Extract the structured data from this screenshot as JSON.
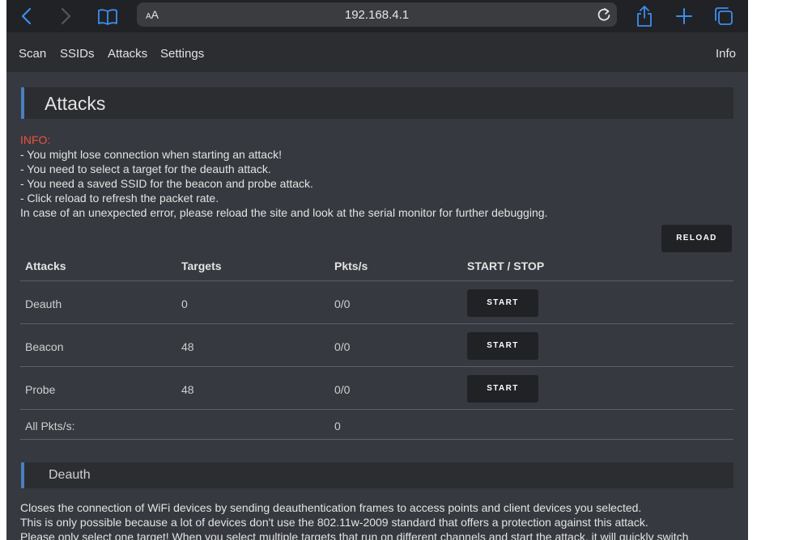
{
  "browser": {
    "url": "192.168.4.1",
    "text_size_label": "AA"
  },
  "nav": {
    "items": [
      {
        "label": "Scan"
      },
      {
        "label": "SSIDs"
      },
      {
        "label": "Attacks"
      },
      {
        "label": "Settings"
      }
    ],
    "right_item": "Info"
  },
  "page": {
    "title": "Attacks"
  },
  "info": {
    "label": "INFO:",
    "lines": [
      "- You might lose connection when starting an attack!",
      "- You need to select a target for the deauth attack.",
      "- You need a saved SSID for the beacon and probe attack.",
      "- Click reload to refresh the packet rate.",
      "In case of an unexpected error, please reload the site and look at the serial monitor for further debugging."
    ]
  },
  "reload_label": "RELOAD",
  "table": {
    "headers": [
      "Attacks",
      "Targets",
      "Pkts/s",
      "START / STOP"
    ],
    "rows": [
      {
        "attack": "Deauth",
        "targets": "0",
        "pkts": "0/0",
        "button": "START"
      },
      {
        "attack": "Beacon",
        "targets": "48",
        "pkts": "0/0",
        "button": "START"
      },
      {
        "attack": "Probe",
        "targets": "48",
        "pkts": "0/0",
        "button": "START"
      }
    ],
    "total_label": "All Pkts/s:",
    "total_value": "0"
  },
  "deauth_section": {
    "title": "Deauth",
    "lines": [
      "Closes the connection of WiFi devices by sending deauthentication frames to access points and client devices you selected.",
      "This is only possible because a lot of devices don't use the 802.11w-2009 standard that offers a protection against this attack.",
      "Please only select one target! When you select multiple targets that run on different channels and start the attack, it will quickly switch"
    ]
  },
  "colors": {
    "accent_blue": "#3d8ef0",
    "info_red": "#f05040",
    "background": "#36393f"
  },
  "icons": [
    "back-icon",
    "forward-icon",
    "bookmarks-icon",
    "reload-page-icon",
    "share-icon",
    "new-tab-icon",
    "tabs-icon"
  ]
}
